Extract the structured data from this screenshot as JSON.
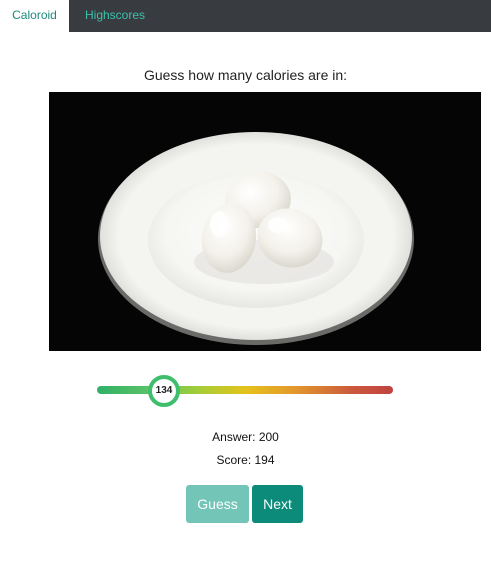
{
  "nav": {
    "tabs": [
      {
        "label": "Caloroid",
        "active": true
      },
      {
        "label": "Highscores",
        "active": false
      }
    ]
  },
  "main": {
    "prompt": "Guess how many calories are in:",
    "image_subject": "three boiled eggs on a white plate",
    "slider": {
      "value": "134",
      "gradient_colors": [
        "#2fb067",
        "#a6cd35",
        "#e4c21c",
        "#e39a2b",
        "#bf4242"
      ]
    },
    "answer_text": "Answer: 200",
    "score_text": "Score: 194",
    "buttons": {
      "guess": "Guess",
      "next": "Next"
    }
  },
  "colors": {
    "topbar": "#383c40",
    "accent": "#0d8b7a",
    "accent_light": "#6cc2b4",
    "slider_thumb_border": "#3fbf6d"
  }
}
